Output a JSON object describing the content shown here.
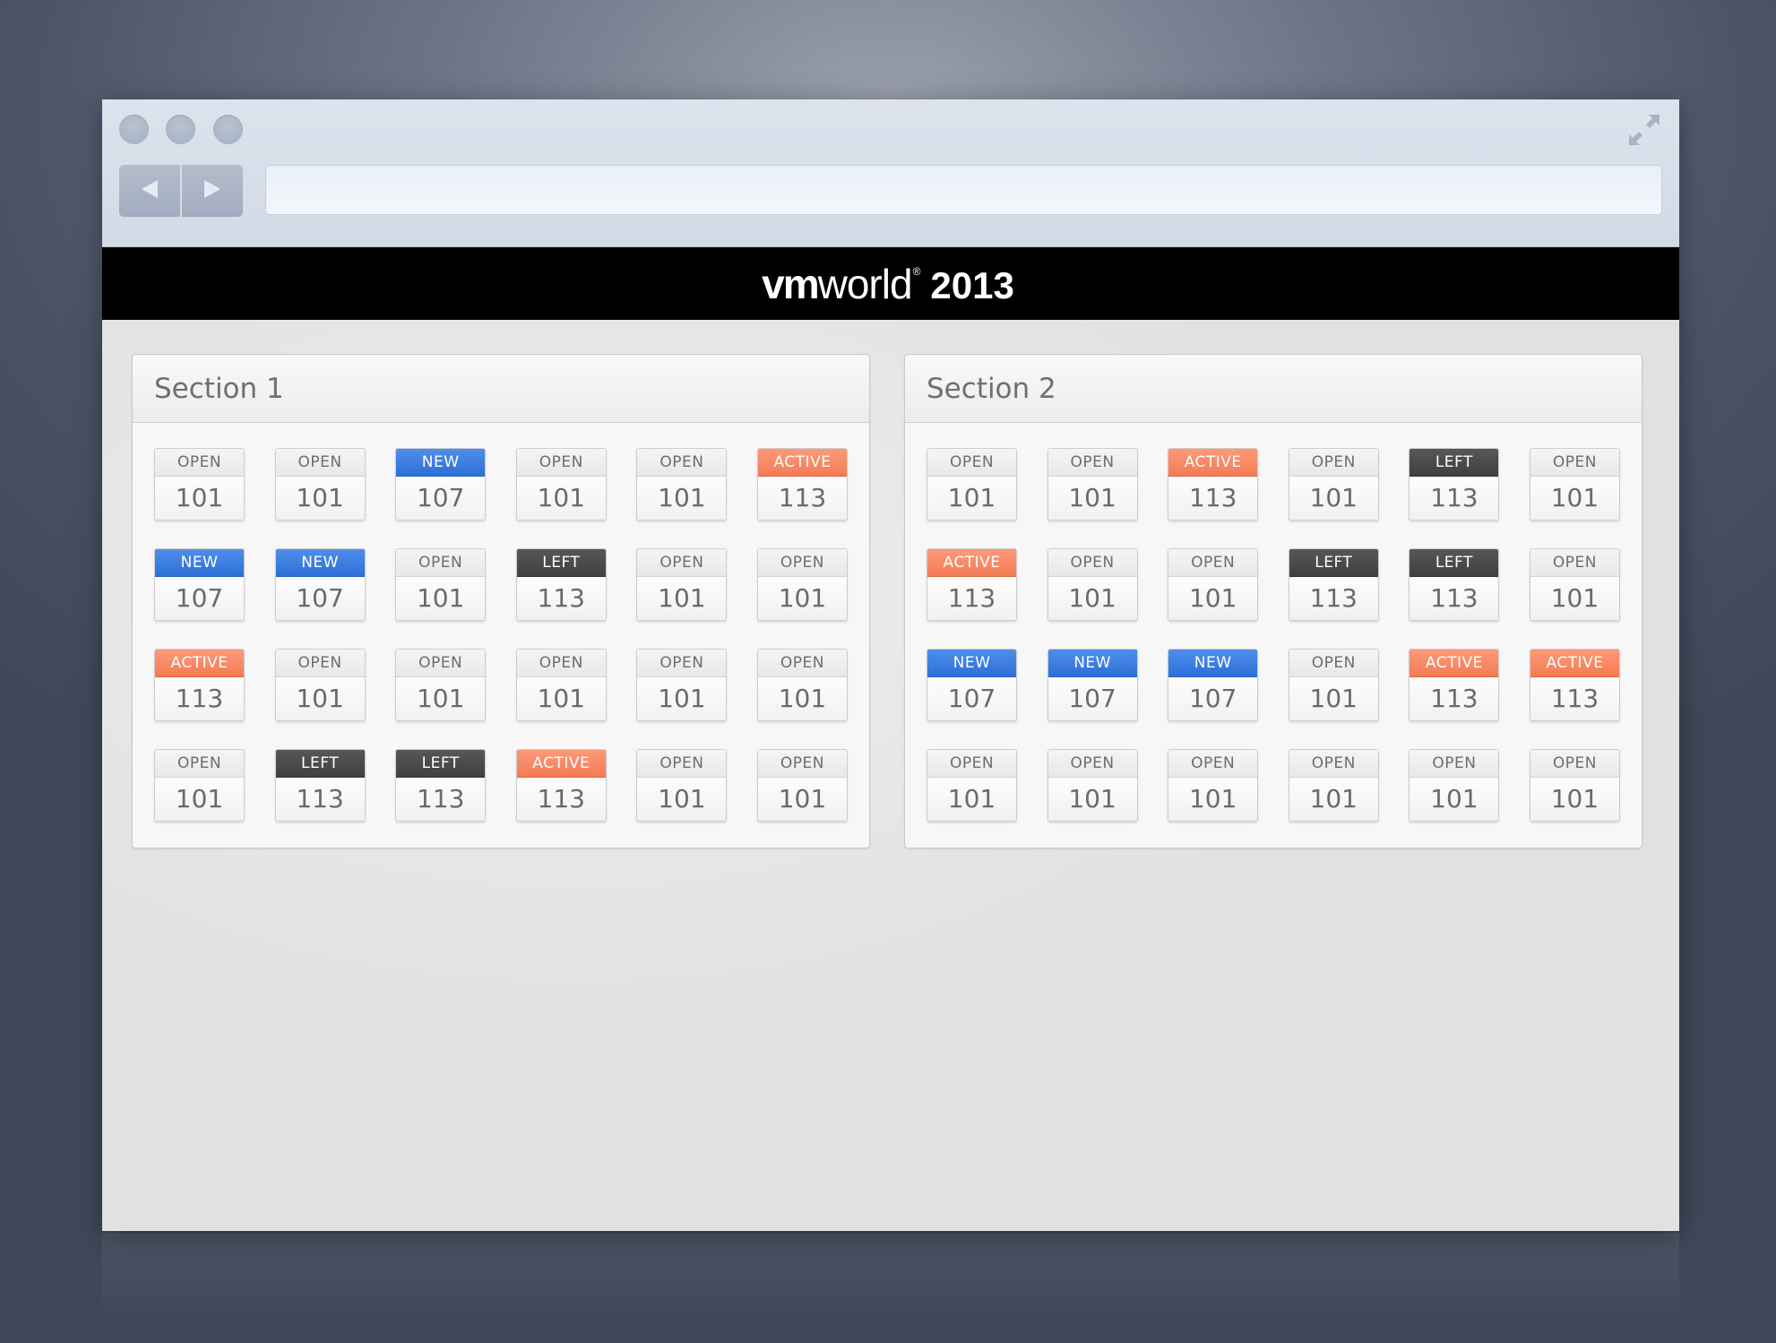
{
  "browser": {
    "url": ""
  },
  "banner": {
    "logo_vm": "vm",
    "logo_world": "world",
    "logo_reg": "®",
    "logo_year": "2013"
  },
  "sections": [
    {
      "title": "Section 1",
      "tiles": [
        {
          "status": "OPEN",
          "number": "101"
        },
        {
          "status": "OPEN",
          "number": "101"
        },
        {
          "status": "NEW",
          "number": "107"
        },
        {
          "status": "OPEN",
          "number": "101"
        },
        {
          "status": "OPEN",
          "number": "101"
        },
        {
          "status": "ACTIVE",
          "number": "113"
        },
        {
          "status": "NEW",
          "number": "107"
        },
        {
          "status": "NEW",
          "number": "107"
        },
        {
          "status": "OPEN",
          "number": "101"
        },
        {
          "status": "LEFT",
          "number": "113"
        },
        {
          "status": "OPEN",
          "number": "101"
        },
        {
          "status": "OPEN",
          "number": "101"
        },
        {
          "status": "ACTIVE",
          "number": "113"
        },
        {
          "status": "OPEN",
          "number": "101"
        },
        {
          "status": "OPEN",
          "number": "101"
        },
        {
          "status": "OPEN",
          "number": "101"
        },
        {
          "status": "OPEN",
          "number": "101"
        },
        {
          "status": "OPEN",
          "number": "101"
        },
        {
          "status": "OPEN",
          "number": "101"
        },
        {
          "status": "LEFT",
          "number": "113"
        },
        {
          "status": "LEFT",
          "number": "113"
        },
        {
          "status": "ACTIVE",
          "number": "113"
        },
        {
          "status": "OPEN",
          "number": "101"
        },
        {
          "status": "OPEN",
          "number": "101"
        }
      ]
    },
    {
      "title": "Section 2",
      "tiles": [
        {
          "status": "OPEN",
          "number": "101"
        },
        {
          "status": "OPEN",
          "number": "101"
        },
        {
          "status": "ACTIVE",
          "number": "113"
        },
        {
          "status": "OPEN",
          "number": "101"
        },
        {
          "status": "LEFT",
          "number": "113"
        },
        {
          "status": "OPEN",
          "number": "101"
        },
        {
          "status": "ACTIVE",
          "number": "113"
        },
        {
          "status": "OPEN",
          "number": "101"
        },
        {
          "status": "OPEN",
          "number": "101"
        },
        {
          "status": "LEFT",
          "number": "113"
        },
        {
          "status": "LEFT",
          "number": "113"
        },
        {
          "status": "OPEN",
          "number": "101"
        },
        {
          "status": "NEW",
          "number": "107"
        },
        {
          "status": "NEW",
          "number": "107"
        },
        {
          "status": "NEW",
          "number": "107"
        },
        {
          "status": "OPEN",
          "number": "101"
        },
        {
          "status": "ACTIVE",
          "number": "113"
        },
        {
          "status": "ACTIVE",
          "number": "113"
        },
        {
          "status": "OPEN",
          "number": "101"
        },
        {
          "status": "OPEN",
          "number": "101"
        },
        {
          "status": "OPEN",
          "number": "101"
        },
        {
          "status": "OPEN",
          "number": "101"
        },
        {
          "status": "OPEN",
          "number": "101"
        },
        {
          "status": "OPEN",
          "number": "101"
        }
      ]
    }
  ],
  "status_colors": {
    "OPEN": "#e8e8e8",
    "NEW": "#2d6fd8",
    "ACTIVE": "#f47b55",
    "LEFT": "#404040"
  },
  "icons": {
    "window_controls": [
      "window-dot-icon",
      "window-dot-icon",
      "window-dot-icon"
    ],
    "expand": "expand-arrows-icon",
    "back": "back-arrow-icon",
    "forward": "forward-arrow-icon"
  }
}
